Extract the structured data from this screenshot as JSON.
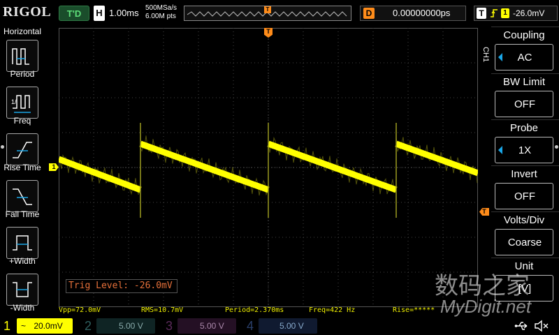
{
  "header": {
    "brand": "RIGOL",
    "run_status": "T'D",
    "timebase_label": "H",
    "timebase": "1.00ms",
    "sample_rate": "500MSa/s",
    "memory_depth": "6.00M pts",
    "trigger_marker": "T",
    "delay_label": "D",
    "delay": "0.00000000ps",
    "trigger_label": "T",
    "trigger_channel": "1",
    "trigger_level": "-26.0mV"
  },
  "left_menu": {
    "title": "Horizontal",
    "items": [
      {
        "label": "Period",
        "icon": "period-icon"
      },
      {
        "label": "Freq",
        "icon": "frequency-icon"
      },
      {
        "label": "Rise Time",
        "icon": "rise-time-icon"
      },
      {
        "label": "Fall Time",
        "icon": "fall-time-icon"
      },
      {
        "label": "+Width",
        "icon": "positive-width-icon"
      },
      {
        "label": "-Width",
        "icon": "negative-width-icon"
      }
    ]
  },
  "right_menu": {
    "channel_tag": "CH1",
    "items": [
      {
        "title": "Coupling",
        "value": "AC",
        "arrow": true
      },
      {
        "title": "BW Limit",
        "value": "OFF",
        "arrow": false
      },
      {
        "title": "Probe",
        "value": "1X",
        "arrow": true
      },
      {
        "title": "Invert",
        "value": "OFF",
        "arrow": false
      },
      {
        "title": "Volts/Div",
        "value": "Coarse",
        "arrow": false
      },
      {
        "title": "Unit",
        "value": "[V]",
        "arrow": false
      }
    ]
  },
  "markers": {
    "ch1_marker": "1",
    "trigger_top": "T",
    "trigger_level_marker": "T"
  },
  "trig_level_text": "Trig Level: -26.0mV",
  "measurements": {
    "vpp": "Vpp=72.0mV",
    "rms": "RMS=10.7mV",
    "period": "Period=2.370ms",
    "freq": "Freq=422 Hz",
    "rise": "Rise=*****"
  },
  "bottom": {
    "channels": [
      {
        "num": "1",
        "coupling": "~",
        "scale": "20.0mV",
        "color": "#ffff00",
        "active": true
      },
      {
        "num": "2",
        "coupling": "",
        "scale": "5.00 V",
        "color": "#00d0d0",
        "active": false
      },
      {
        "num": "3",
        "coupling": "",
        "scale": "5.00 V",
        "color": "#d000d0",
        "active": false
      },
      {
        "num": "4",
        "coupling": "",
        "scale": "5.00 V",
        "color": "#3a7bff",
        "active": false
      }
    ]
  },
  "watermark": {
    "line1": "数码之家",
    "line2": "MyDigit.net"
  },
  "colors": {
    "ch1": "#ffff00",
    "trigger": "#ff8c1a",
    "accent": "#1aa7e8"
  }
}
